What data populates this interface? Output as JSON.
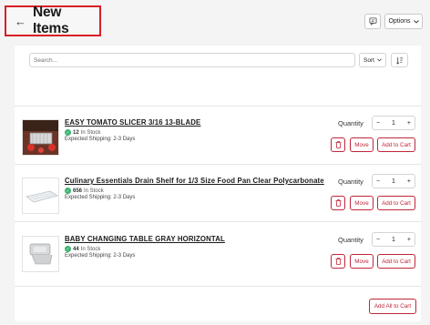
{
  "header": {
    "title": "New Items",
    "options_label": "Options"
  },
  "toolbar": {
    "search_placeholder": "Search...",
    "sort_label": "Sort"
  },
  "quantity_label": "Quantity",
  "buttons": {
    "move": "Move",
    "add_to_cart": "Add to Cart",
    "add_all": "Add All to Cart"
  },
  "items": [
    {
      "name": "EASY TOMATO SLICER 3/16 13-BLADE",
      "stock_count": "12",
      "stock_label": "In Stock",
      "shipping": "Expected Shipping: 2-3 Days",
      "quantity": "1"
    },
    {
      "name": "Culinary Essentials Drain Shelf for 1/3 Size Food Pan Clear Polycarbonate",
      "stock_count": "656",
      "stock_label": "In Stock",
      "shipping": "Expected Shipping: 2-3 Days",
      "quantity": "1"
    },
    {
      "name": "BABY CHANGING TABLE GRAY HORIZONTAL",
      "stock_count": "44",
      "stock_label": "In Stock",
      "shipping": "Expected Shipping: 2-3 Days",
      "quantity": "1"
    }
  ],
  "colors": {
    "accent": "#c0263a",
    "highlight_border": "#d91f26",
    "in_stock": "#3cb371"
  }
}
